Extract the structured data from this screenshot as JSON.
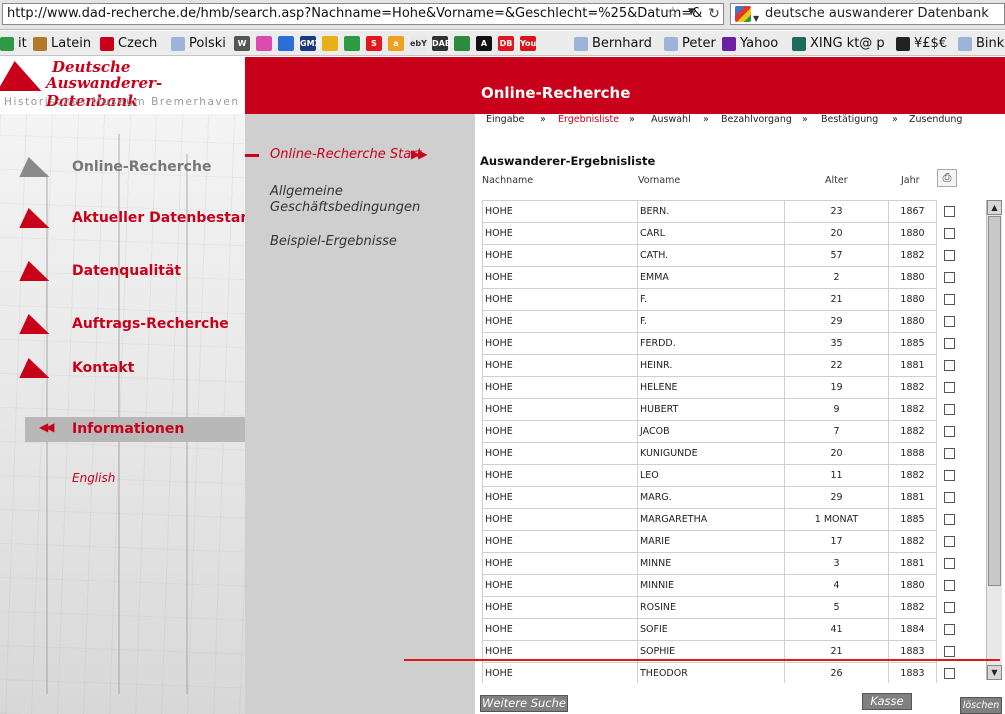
{
  "browser": {
    "url": "http://www.dad-recherche.de/hmb/search.asp?Nachname=Hohe&Vorname=&Geschlecht=%25&Datum=&",
    "search_query": "deutsche auswanderer Datenbank",
    "bookmarks": [
      {
        "label": "it",
        "icon": "italy-flag-icon",
        "color": "#2e9a45"
      },
      {
        "label": "Latein",
        "icon": "book-icon",
        "color": "#b07a2a"
      },
      {
        "label": "Czech",
        "icon": "alpha-icon",
        "color": "#c8001a"
      },
      {
        "label": "Polski",
        "icon": "page-icon",
        "color": "#9db4d8"
      },
      {
        "label": "Bernhard",
        "icon": "page-icon",
        "color": "#9db4d8"
      },
      {
        "label": "Peter",
        "icon": "page-icon",
        "color": "#9db4d8"
      },
      {
        "label": "Yahoo",
        "icon": "yahoo-icon",
        "color": "#6b1fa3"
      },
      {
        "label": "XING kt@ p",
        "icon": "xing-icon",
        "color": "#1d6b5a"
      },
      {
        "label": "¥£$€",
        "icon": "currency-icon",
        "color": "#222222"
      },
      {
        "label": "Bink",
        "icon": "page-icon",
        "color": "#9db4d8"
      }
    ],
    "icon_strip": [
      {
        "glyph": "W",
        "color": "#555555"
      },
      {
        "glyph": "",
        "color": "#d84bb0"
      },
      {
        "glyph": "",
        "color": "#2a6fd6"
      },
      {
        "glyph": "GMX",
        "color": "#1a3a7a"
      },
      {
        "glyph": "",
        "color": "#e8b018"
      },
      {
        "glyph": "",
        "color": "#2e9a45"
      },
      {
        "glyph": "S",
        "color": "#e0181e"
      },
      {
        "glyph": "a",
        "color": "#f0a020"
      },
      {
        "glyph": "ebY",
        "color": "#e8e8e8"
      },
      {
        "glyph": "DAB",
        "color": "#333333"
      },
      {
        "glyph": "",
        "color": "#2e8a3e"
      },
      {
        "glyph": "A",
        "color": "#111111"
      },
      {
        "glyph": "DB",
        "color": "#e0181e"
      },
      {
        "glyph": "You",
        "color": "#d81818"
      }
    ]
  },
  "logo": {
    "line1": "Deutsche",
    "line2": "Auswanderer-Datenbank",
    "tagline": "Historisches Museum Bremerhaven"
  },
  "header": {
    "title": "Online-Recherche"
  },
  "steps": [
    {
      "label": "Eingabe",
      "active": false
    },
    {
      "label": "Ergebnisliste",
      "active": true
    },
    {
      "label": "Auswahl",
      "active": false
    },
    {
      "label": "Bezahlvorgang",
      "active": false
    },
    {
      "label": "Bestätigung",
      "active": false
    },
    {
      "label": "Zusendung",
      "active": false
    }
  ],
  "step_separator": "»",
  "nav": {
    "items": [
      {
        "label": "Online-Recherche",
        "active": true
      },
      {
        "label": "Aktueller Datenbestand",
        "active": false
      },
      {
        "label": "Datenqualität",
        "active": false
      },
      {
        "label": "Auftrags-Recherche",
        "active": false
      },
      {
        "label": "Kontakt",
        "active": false
      }
    ],
    "info": "Informationen",
    "info_arrows": "◀◀",
    "english": "English"
  },
  "submenu": {
    "start": "Online-Recherche Start",
    "start_arrows": "▶▶",
    "agb_line1": "Allgemeine",
    "agb_line2": "Geschäftsbedingungen",
    "examples": "Beispiel-Ergebnisse"
  },
  "results": {
    "title": "Auswanderer-Ergebnisliste",
    "columns": {
      "lastname": "Nachname",
      "firstname": "Vorname",
      "age": "Alter",
      "year": "Jahr"
    },
    "rows": [
      {
        "lastname": "HOHE",
        "firstname": "BERN.",
        "age": "23",
        "year": "1867"
      },
      {
        "lastname": "HOHE",
        "firstname": "CARL",
        "age": "20",
        "year": "1880"
      },
      {
        "lastname": "HOHE",
        "firstname": "CATH.",
        "age": "57",
        "year": "1882"
      },
      {
        "lastname": "HOHE",
        "firstname": "EMMA",
        "age": "2",
        "year": "1880"
      },
      {
        "lastname": "HOHE",
        "firstname": "F.",
        "age": "21",
        "year": "1880"
      },
      {
        "lastname": "HOHE",
        "firstname": "F.",
        "age": "29",
        "year": "1880"
      },
      {
        "lastname": "HOHE",
        "firstname": "FERDD.",
        "age": "35",
        "year": "1885"
      },
      {
        "lastname": "HOHE",
        "firstname": "HEINR.",
        "age": "22",
        "year": "1881"
      },
      {
        "lastname": "HOHE",
        "firstname": "HELENE",
        "age": "19",
        "year": "1882"
      },
      {
        "lastname": "HOHE",
        "firstname": "HUBERT",
        "age": "9",
        "year": "1882"
      },
      {
        "lastname": "HOHE",
        "firstname": "JACOB",
        "age": "7",
        "year": "1882"
      },
      {
        "lastname": "HOHE",
        "firstname": "KUNIGUNDE",
        "age": "20",
        "year": "1888"
      },
      {
        "lastname": "HOHE",
        "firstname": "LEO",
        "age": "11",
        "year": "1882"
      },
      {
        "lastname": "HOHE",
        "firstname": "MARG.",
        "age": "29",
        "year": "1881"
      },
      {
        "lastname": "HOHE",
        "firstname": "MARGARETHA",
        "age": "1 MONAT",
        "year": "1885"
      },
      {
        "lastname": "HOHE",
        "firstname": "MARIE",
        "age": "17",
        "year": "1882"
      },
      {
        "lastname": "HOHE",
        "firstname": "MINNE",
        "age": "3",
        "year": "1881"
      },
      {
        "lastname": "HOHE",
        "firstname": "MINNIE",
        "age": "4",
        "year": "1880"
      },
      {
        "lastname": "HOHE",
        "firstname": "ROSINE",
        "age": "5",
        "year": "1882"
      },
      {
        "lastname": "HOHE",
        "firstname": "SOFIE",
        "age": "41",
        "year": "1884"
      },
      {
        "lastname": "HOHE",
        "firstname": "SOPHIE",
        "age": "21",
        "year": "1883"
      },
      {
        "lastname": "HOHE",
        "firstname": "THEODOR",
        "age": "26",
        "year": "1883"
      }
    ]
  },
  "buttons": {
    "new_search": "Weitere Suche",
    "checkout": "Kasse",
    "delete": "löschen"
  },
  "colors": {
    "brand_red": "#c8001a",
    "panel_grey": "#cfcfcf",
    "annotation_line": "#e01818"
  }
}
